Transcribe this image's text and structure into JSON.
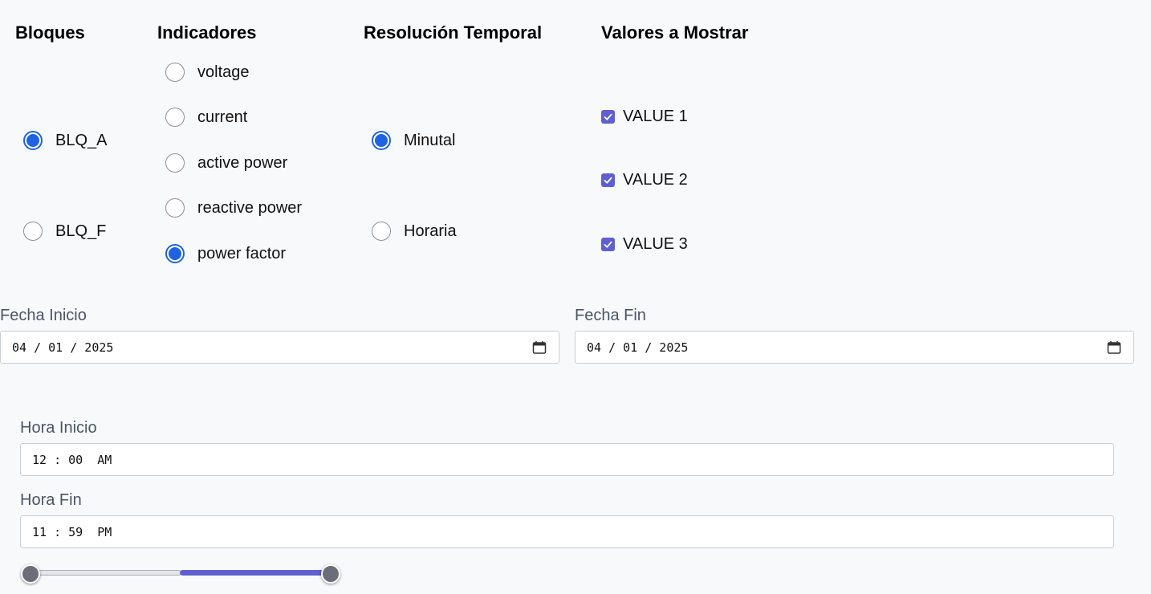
{
  "bloques": {
    "title": "Bloques",
    "options": [
      {
        "label": "BLQ_A",
        "checked": true
      },
      {
        "label": "BLQ_F",
        "checked": false
      }
    ]
  },
  "indicadores": {
    "title": "Indicadores",
    "options": [
      {
        "label": "voltage",
        "checked": false
      },
      {
        "label": "current",
        "checked": false
      },
      {
        "label": "active power",
        "checked": false
      },
      {
        "label": "reactive power",
        "checked": false
      },
      {
        "label": "power factor",
        "checked": true
      }
    ]
  },
  "resolucion": {
    "title": "Resolución Temporal",
    "options": [
      {
        "label": "Minutal",
        "checked": true
      },
      {
        "label": "Horaria",
        "checked": false
      }
    ]
  },
  "valores": {
    "title": "Valores a Mostrar",
    "options": [
      {
        "label": "VALUE 1",
        "checked": true
      },
      {
        "label": "VALUE 2",
        "checked": true
      },
      {
        "label": "VALUE 3",
        "checked": true
      }
    ]
  },
  "fecha_inicio": {
    "label": "Fecha Inicio",
    "value": "04 / 01 / 2025"
  },
  "fecha_fin": {
    "label": "Fecha Fin",
    "value": "04 / 01 / 2025"
  },
  "hora_inicio": {
    "label": "Hora Inicio",
    "value": "12 : 00  AM"
  },
  "hora_fin": {
    "label": "Hora Fin",
    "value": "11 : 59  PM"
  },
  "time_slider": {
    "start_fraction": 0.0,
    "end_fraction": 1.0
  },
  "colors": {
    "radio_accent": "#1f62e3",
    "checkbox_accent": "#5f5fcf",
    "label_gray": "#4a5566"
  }
}
